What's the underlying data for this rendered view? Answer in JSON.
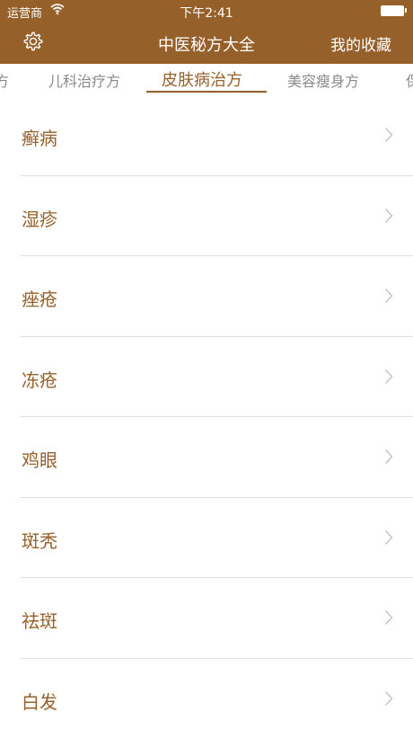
{
  "status_bar": {
    "carrier": "运营商",
    "time": "下午2:41"
  },
  "nav": {
    "title": "中医秘方大全",
    "favorites_label": "我的收藏"
  },
  "tabs": [
    {
      "label": "方",
      "active": false
    },
    {
      "label": "儿科治疗方",
      "active": false
    },
    {
      "label": "皮肤病治方",
      "active": true
    },
    {
      "label": "美容瘦身方",
      "active": false
    },
    {
      "label": "保",
      "active": false
    }
  ],
  "list": [
    {
      "label": "癣病"
    },
    {
      "label": "湿疹"
    },
    {
      "label": "痤疮"
    },
    {
      "label": "冻疮"
    },
    {
      "label": "鸡眼"
    },
    {
      "label": "斑秃"
    },
    {
      "label": "祛斑"
    },
    {
      "label": "白发"
    }
  ],
  "colors": {
    "brand": "#96602a",
    "divider": "#e2e2e2",
    "chevron": "#c7c7cc",
    "inactive_tab": "#8a8a8a"
  },
  "icons": {
    "settings": "gear-icon",
    "wifi": "wifi-icon",
    "battery": "battery-icon",
    "chevron": "chevron-right-icon"
  }
}
